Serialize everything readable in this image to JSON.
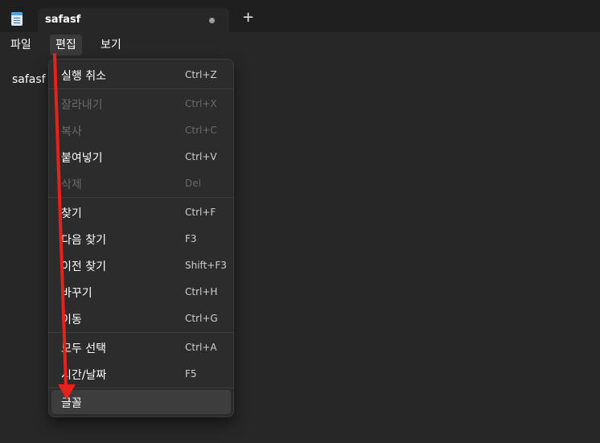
{
  "window": {
    "tab_title": "safasf",
    "new_tab_symbol": "+"
  },
  "menubar": {
    "items": [
      "파일",
      "편집",
      "보기"
    ]
  },
  "editor": {
    "content": "safasf"
  },
  "edit_menu": {
    "items": [
      {
        "label": "실행 취소",
        "shortcut": "Ctrl+Z",
        "enabled": true
      },
      {
        "label": "잘라내기",
        "shortcut": "Ctrl+X",
        "enabled": false
      },
      {
        "label": "복사",
        "shortcut": "Ctrl+C",
        "enabled": false
      },
      {
        "label": "붙여넣기",
        "shortcut": "Ctrl+V",
        "enabled": true
      },
      {
        "label": "삭제",
        "shortcut": "Del",
        "enabled": false
      },
      {
        "label": "찾기",
        "shortcut": "Ctrl+F",
        "enabled": true
      },
      {
        "label": "다음 찾기",
        "shortcut": "F3",
        "enabled": true
      },
      {
        "label": "이전 찾기",
        "shortcut": "Shift+F3",
        "enabled": true
      },
      {
        "label": "바꾸기",
        "shortcut": "Ctrl+H",
        "enabled": true
      },
      {
        "label": "이동",
        "shortcut": "Ctrl+G",
        "enabled": true
      },
      {
        "label": "모두 선택",
        "shortcut": "Ctrl+A",
        "enabled": true
      },
      {
        "label": "시간/날짜",
        "shortcut": "F5",
        "enabled": true
      },
      {
        "label": "글꼴",
        "shortcut": "",
        "enabled": true,
        "highlighted": true
      }
    ]
  },
  "colors": {
    "background": "#272727",
    "titlebar": "#1f1f1f",
    "menu": "#2c2c2c",
    "annotation_arrow": "#e8211b"
  }
}
